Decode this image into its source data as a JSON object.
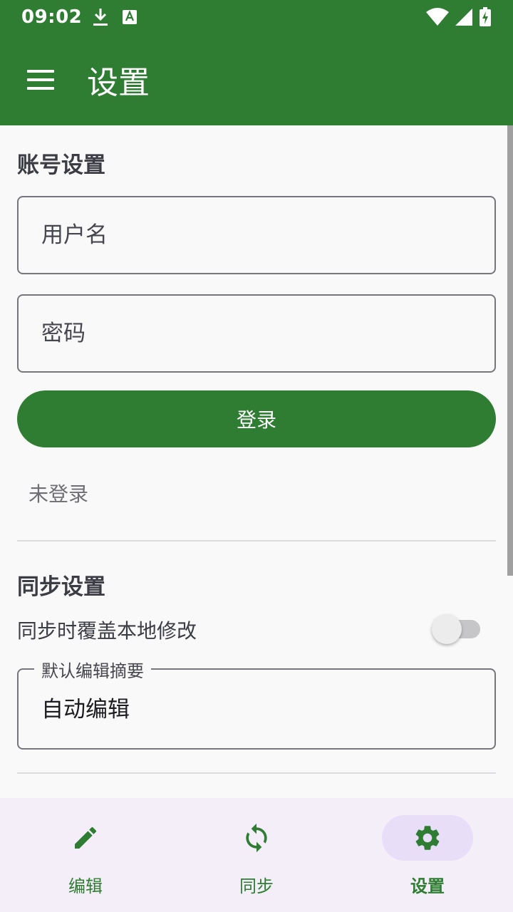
{
  "status_bar": {
    "time": "09:02",
    "icons": [
      "download-icon",
      "text-notification-icon",
      "wifi-icon",
      "cellular-signal-icon",
      "battery-charging-icon"
    ]
  },
  "app_bar": {
    "menu_icon": "menu-icon",
    "title": "设置"
  },
  "account_section": {
    "title": "账号设置",
    "username_placeholder": "用户名",
    "username_value": "",
    "password_placeholder": "密码",
    "password_value": "",
    "login_button": "登录",
    "status": "未登录"
  },
  "sync_section": {
    "title": "同步设置",
    "overwrite_label": "同步时覆盖本地修改",
    "overwrite_enabled": false,
    "summary_label": "默认编辑摘要",
    "summary_value": "自动编辑"
  },
  "bottom_nav": {
    "items": [
      {
        "label": "编辑",
        "icon": "pencil-icon",
        "active": false
      },
      {
        "label": "同步",
        "icon": "sync-icon",
        "active": false
      },
      {
        "label": "设置",
        "icon": "gear-icon",
        "active": true
      }
    ]
  },
  "colors": {
    "primary": "#2e7d32",
    "background": "#f9f9f9",
    "nav_background": "#f3eef7",
    "nav_active_indicator": "#e8def8"
  }
}
